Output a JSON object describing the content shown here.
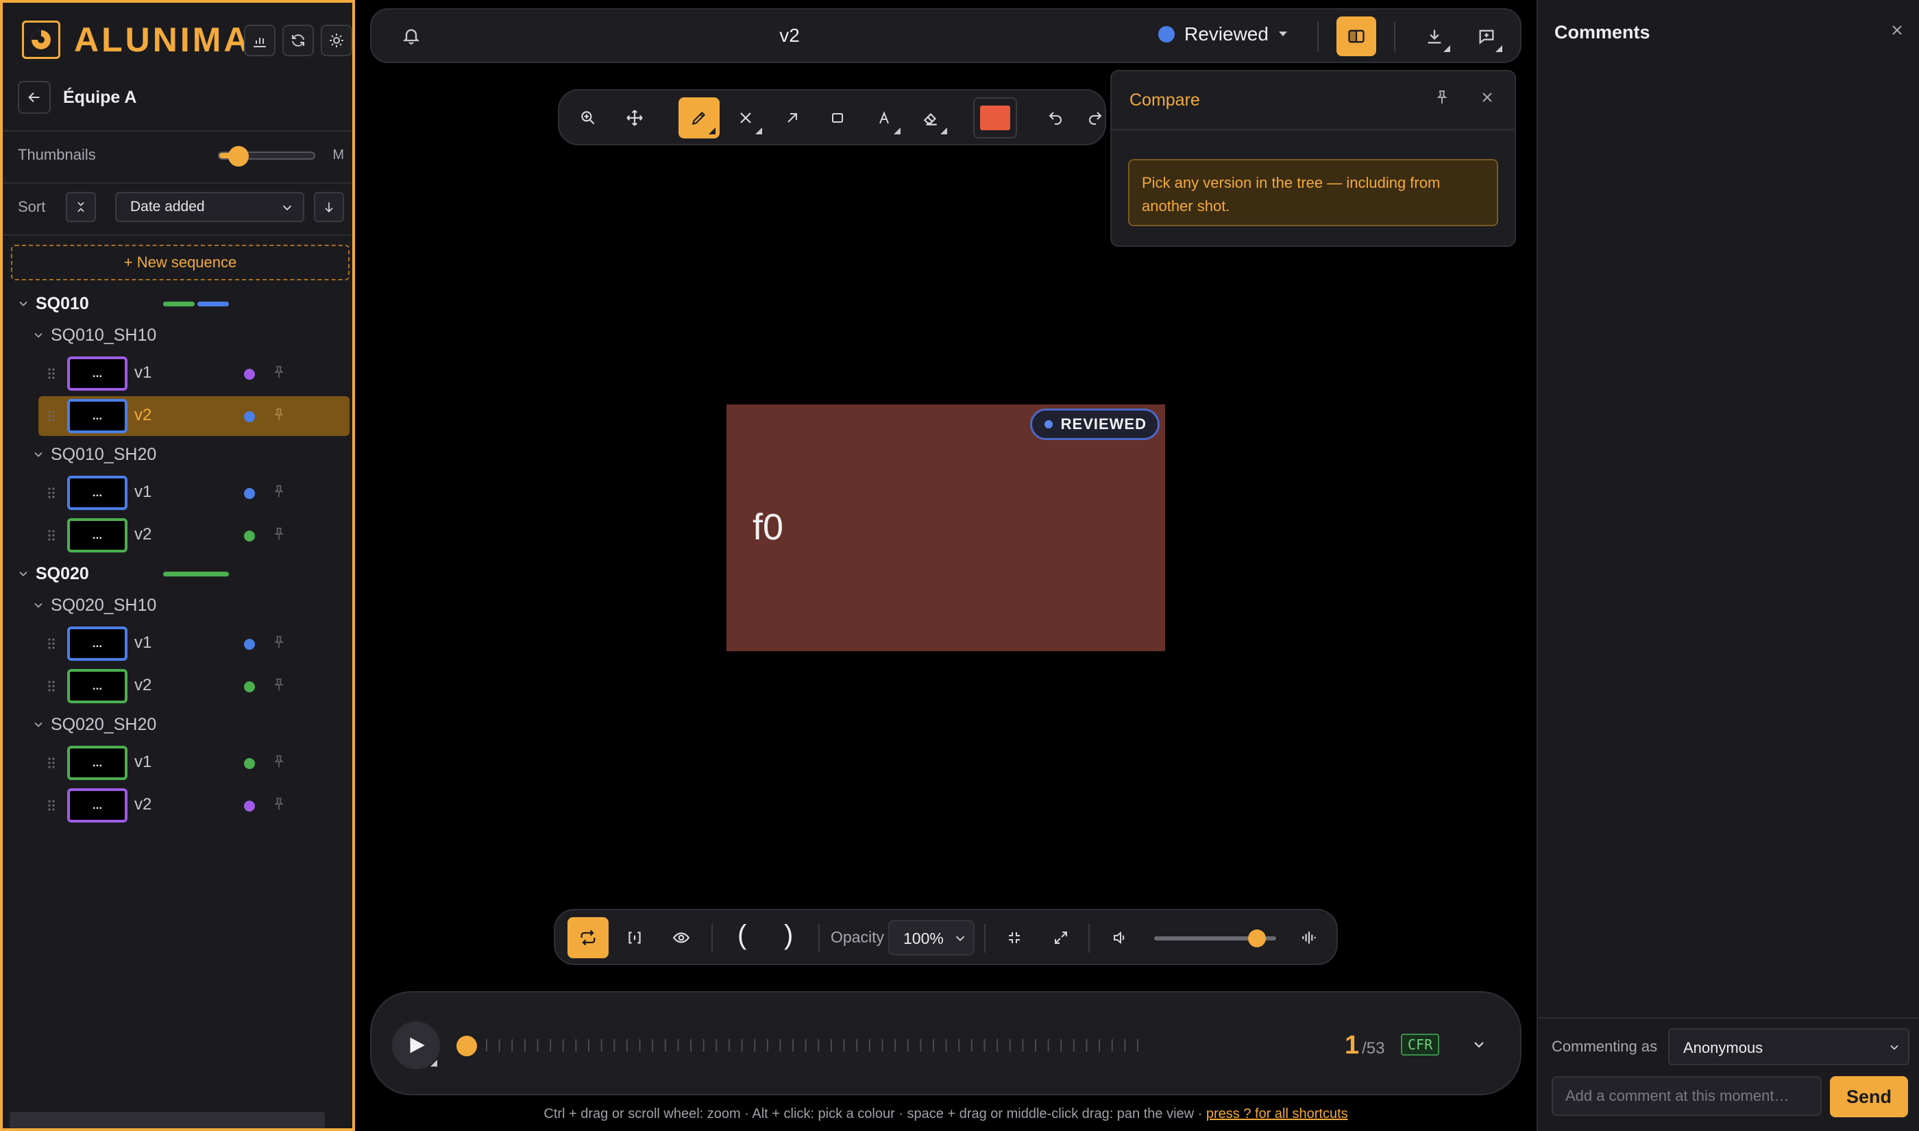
{
  "app": {
    "brand": "ALUNIMA",
    "team_name": "Équipe A"
  },
  "sidebar": {
    "thumbnails_label": "Thumbnails",
    "thumbnail_size": "M",
    "thumbnail_slider_fraction": 0.2,
    "sort_label": "Sort",
    "sort_value": "Date added",
    "new_sequence_label": "+ New sequence",
    "sequences": [
      {
        "name": "SQ010",
        "progress": [
          {
            "color": "#4caf50",
            "fraction": 0.5
          },
          {
            "color": "#4b7fe8",
            "fraction": 0.5
          }
        ],
        "shots": [
          {
            "name": "SQ010_SH10",
            "versions": [
              {
                "label": "v1",
                "thumb": "...",
                "color": "#a05be8",
                "active": false
              },
              {
                "label": "v2",
                "thumb": "...",
                "color": "#4b7fe8",
                "active": true
              }
            ]
          },
          {
            "name": "SQ010_SH20",
            "versions": [
              {
                "label": "v1",
                "thumb": "...",
                "color": "#4b7fe8",
                "active": false
              },
              {
                "label": "v2",
                "thumb": "...",
                "color": "#4caf50",
                "active": false
              }
            ]
          }
        ]
      },
      {
        "name": "SQ020",
        "progress": [
          {
            "color": "#4caf50",
            "fraction": 1.0
          }
        ],
        "shots": [
          {
            "name": "SQ020_SH10",
            "versions": [
              {
                "label": "v1",
                "thumb": "...",
                "color": "#4b7fe8",
                "active": false
              },
              {
                "label": "v2",
                "thumb": "...",
                "color": "#4caf50",
                "active": false
              }
            ]
          },
          {
            "name": "SQ020_SH20",
            "versions": [
              {
                "label": "v1",
                "thumb": "...",
                "color": "#4caf50",
                "active": false
              },
              {
                "label": "v2",
                "thumb": "...",
                "color": "#a05be8",
                "active": false
              }
            ]
          }
        ]
      }
    ]
  },
  "header": {
    "title": "v2",
    "status": "Reviewed",
    "status_color": "#4b7fe8"
  },
  "compare": {
    "title": "Compare",
    "note": "Pick any version in the tree — including from another shot."
  },
  "viewer": {
    "frame_label": "f0",
    "badge": "REVIEWED",
    "frame_color": "#66312a"
  },
  "drawing": {
    "color": "#ea5a3d"
  },
  "playback": {
    "opacity_label": "Opacity",
    "opacity_value": "100%",
    "in_mark": "(",
    "out_mark": ")",
    "volume_fraction": 0.84
  },
  "timeline": {
    "current_frame": "1",
    "total_frames": "/53",
    "mode_badge": "CFR",
    "tick_count": 53
  },
  "hint": {
    "text": "Ctrl + drag or scroll wheel: zoom · Alt + click: pick a colour · space + drag or middle-click drag: pan the view · ",
    "link": "press ? for all shortcuts"
  },
  "comments": {
    "title": "Comments",
    "commenting_as_label": "Commenting as",
    "commenter": "Anonymous",
    "placeholder": "Add a comment at this moment…",
    "send_label": "Send"
  },
  "colors": {
    "accent": "#f3aa3c",
    "panel": "#1d1d22",
    "background": "#000000"
  }
}
